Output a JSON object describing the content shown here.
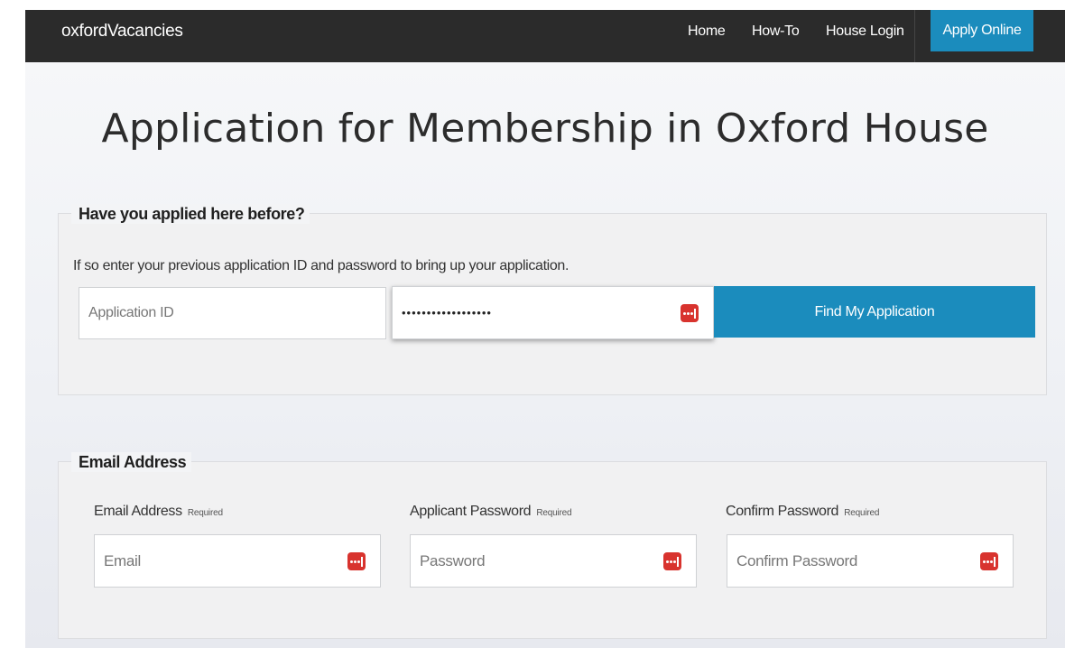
{
  "navbar": {
    "brand": "oxfordVacancies",
    "links": [
      "Home",
      "How-To",
      "House Login"
    ],
    "apply_label": "Apply Online"
  },
  "page": {
    "title": "Application for Membership in Oxford House"
  },
  "previous_application": {
    "legend": "Have you applied here before?",
    "intro": "If so enter your previous application ID and password to bring up your application.",
    "app_id_placeholder": "Application ID",
    "password_value": "••••••••••••••••••",
    "find_button_label": "Find My Application"
  },
  "email_section": {
    "legend": "Email Address",
    "required_text": "Required",
    "email_label": "Email Address",
    "email_placeholder": "Email",
    "password_label": "Applicant Password",
    "password_placeholder": "Password",
    "confirm_label": "Confirm Password",
    "confirm_placeholder": "Confirm Password"
  },
  "icons": {
    "password_manager": "password-manager-icon"
  },
  "colors": {
    "navbar_bg": "#2b2b2b",
    "accent_blue": "#1b8cbd",
    "password_manager_red": "#d8332e",
    "panel_bg": "#f1f1f2"
  }
}
